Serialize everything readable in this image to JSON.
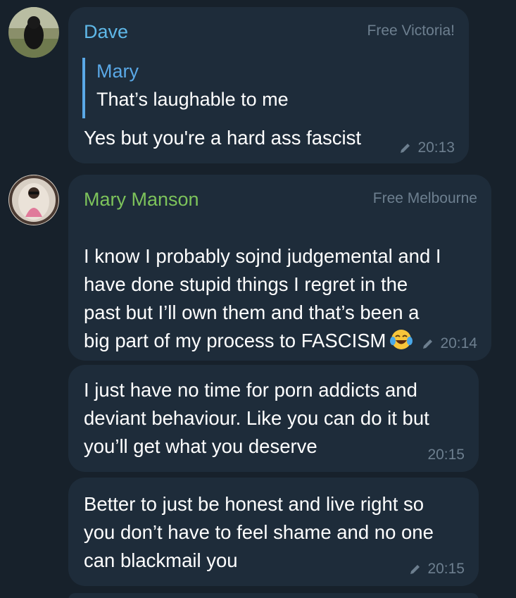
{
  "messages": [
    {
      "sender": "Dave",
      "rank": "Free Victoria!",
      "reply": {
        "name": "Mary",
        "text": "That’s laughable to me"
      },
      "text": "Yes but you're a hard ass fascist",
      "time": "20:13",
      "edited": true
    },
    {
      "sender": "Mary Manson",
      "rank": "Free Melbourne",
      "text": "I know I probably sojnd judgemental and I\nhave done stupid things I regret in the\npast but I’ll own them and that’s been a\nbig part of my process to FASCISM",
      "emoji": "tears-of-joy-emoji",
      "time": "20:14",
      "edited": true
    },
    {
      "text": "I just have no time for porn addicts and\ndeviant behaviour. Like you can do it but\nyou’ll get what you deserve",
      "time": "20:15",
      "edited": false
    },
    {
      "text": "Better to just be honest and live right so\nyou don’t have to feel shame and no one\ncan blackmail you",
      "time": "20:15",
      "edited": true
    }
  ],
  "colors": {
    "background": "#17212b",
    "bubble": "#1e2c3a",
    "dave_name": "#5fb8e8",
    "mary_name": "#7dc35b",
    "reply_accent": "#5aa8e6",
    "meta": "#6d7f8f"
  },
  "icons": {
    "edited": "pencil-icon",
    "dave_avatar": "user-avatar-dave",
    "mary_avatar": "user-avatar-mary"
  }
}
